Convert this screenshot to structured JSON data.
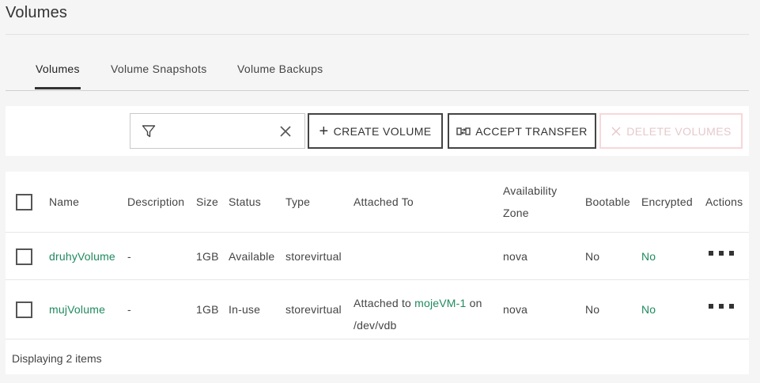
{
  "page": {
    "title": "Volumes"
  },
  "tabs": [
    {
      "label": "Volumes",
      "active": true
    },
    {
      "label": "Volume Snapshots",
      "active": false
    },
    {
      "label": "Volume Backups",
      "active": false
    }
  ],
  "toolbar": {
    "filter_value": "",
    "filter_icon": "filter-icon",
    "clear_icon": "close-icon",
    "create_label": "CREATE VOLUME",
    "accept_label": "ACCEPT TRANSFER",
    "delete_label": "DELETE VOLUMES"
  },
  "table": {
    "headers": {
      "name": "Name",
      "description": "Description",
      "size": "Size",
      "status": "Status",
      "type": "Type",
      "attached_to": "Attached To",
      "availability_zone_line1": "Availability",
      "availability_zone_line2": "Zone",
      "bootable": "Bootable",
      "encrypted": "Encrypted",
      "actions": "Actions"
    },
    "rows": [
      {
        "name": "druhyVolume",
        "description": "-",
        "size": "1GB",
        "status": "Available",
        "type": "storevirtual",
        "attached_prefix": "",
        "attached_vm": "",
        "attached_suffix": "",
        "attached_device": "",
        "availability_zone": "nova",
        "bootable": "No",
        "encrypted": "No"
      },
      {
        "name": "mujVolume",
        "description": "-",
        "size": "1GB",
        "status": "In-use",
        "type": "storevirtual",
        "attached_prefix": "Attached to ",
        "attached_vm": "mojeVM-1",
        "attached_suffix": " on",
        "attached_device": "/dev/vdb",
        "availability_zone": "nova",
        "bootable": "No",
        "encrypted": "No"
      }
    ],
    "footer": "Displaying 2 items"
  },
  "colors": {
    "link": "#1f8a5e",
    "delete_border": "#f7d7da"
  }
}
